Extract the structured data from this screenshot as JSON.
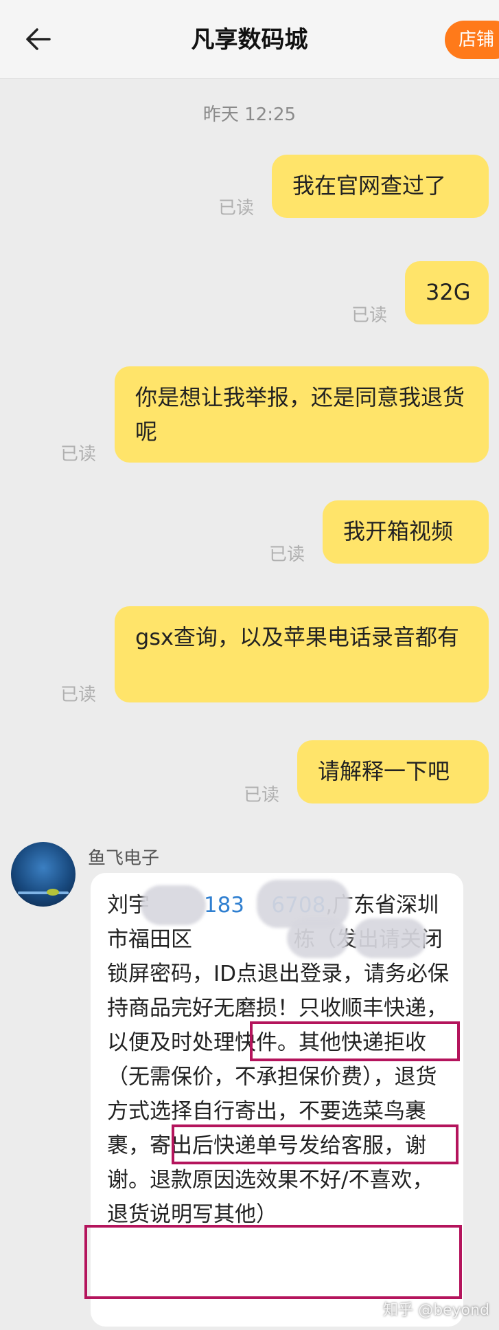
{
  "header": {
    "title": "凡享数码城",
    "shop_button": "店铺"
  },
  "timestamp": "昨天  12:25",
  "outgoing_messages": [
    {
      "text": "我在官网查过了",
      "status": "已读"
    },
    {
      "text": "32G",
      "status": "已读"
    },
    {
      "text": "你是想让我举报，还是同意我退货呢",
      "status": "已读"
    },
    {
      "text": "我开箱视频",
      "status": "已读"
    },
    {
      "text": "gsx查询，以及苹果电话录音都有",
      "status": "已读"
    },
    {
      "text": "请解释一下吧",
      "status": "已读"
    }
  ],
  "incoming_message": {
    "sender": "鱼飞电子",
    "name_prefix": "刘宇",
    "phone": "183    6708",
    "after_phone": ",广东",
    "address_line": "省深圳市福田区",
    "address_end": "栋（发出请关闭锁屏密码，ID点退出登录，请务必保持商品完好无磨损！",
    "highlight1": "只收顺丰快递，",
    "mid1": "以便及时处理快件。其他快递拒收（无需保价，不承担保价费），",
    "highlight2": "退货方式选择自行寄",
    "mid2": "出，不要选菜鸟裹裹，寄出后快递单号发给客服，谢谢。退",
    "highlight3": "款原因选效果不好/不喜欢，退货说明写其他）"
  },
  "watermark": "知乎 @beyond"
}
